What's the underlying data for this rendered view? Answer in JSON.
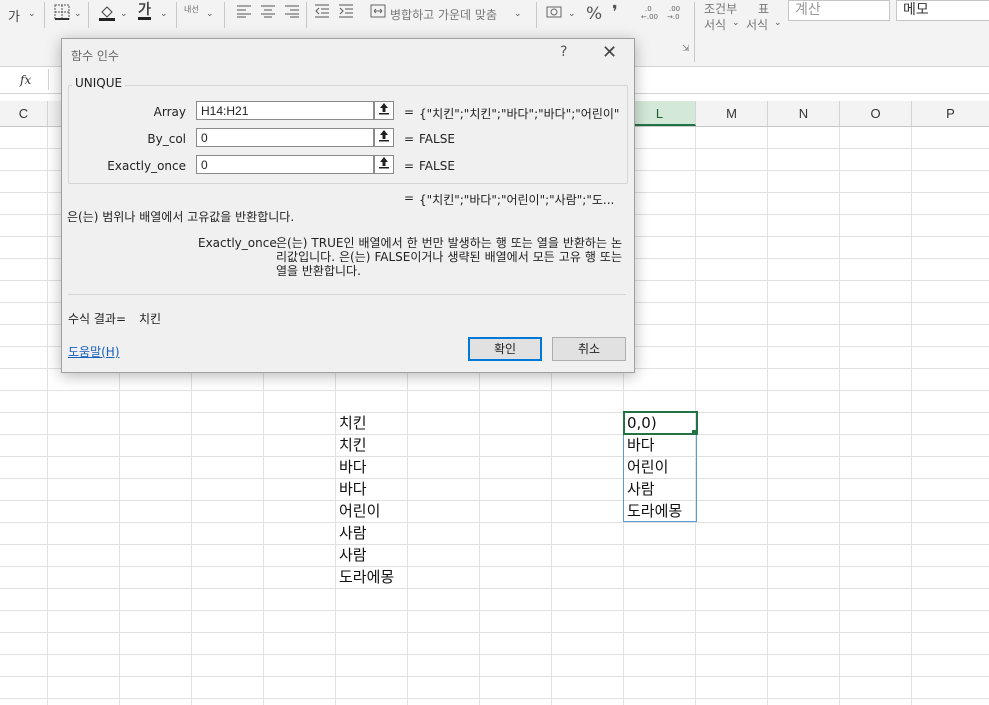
{
  "ribbon": {
    "font_size_glyph": "가",
    "font_color_glyph": "가",
    "border_icon": "border-icon",
    "fill_icon": "fill-color-icon",
    "vertical_text_label": "내선",
    "merge_center_label": "병합하고 가운데 맞춤",
    "percent_label": "%",
    "comma_label": "❜",
    "conditional_format_label": "조건부",
    "conditional_format_sub": "서식",
    "table_format_label": "표",
    "table_format_sub": "서식",
    "style_calc": "계산",
    "style_memo": "메모"
  },
  "formula_bar": {
    "fx_label": "fx"
  },
  "columns": [
    {
      "label": "C"
    },
    {
      "label": ""
    },
    {
      "label": ""
    },
    {
      "label": ""
    },
    {
      "label": ""
    },
    {
      "label": ""
    },
    {
      "label": ""
    },
    {
      "label": ""
    },
    {
      "label": ""
    },
    {
      "label": "L"
    },
    {
      "label": "M"
    },
    {
      "label": "N"
    },
    {
      "label": "O"
    },
    {
      "label": "P"
    }
  ],
  "cells": {
    "h_column": [
      "치킨",
      "치킨",
      "바다",
      "바다",
      "어린이",
      "사람",
      "사람",
      "도라에몽"
    ],
    "l_column": [
      "0,0)",
      "바다",
      "어린이",
      "사람",
      "도라에몽"
    ]
  },
  "dialog": {
    "title": "함수 인수",
    "help_glyph": "?",
    "close_glyph": "✕",
    "function_name": "UNIQUE",
    "args": [
      {
        "label": "Array",
        "value": "H14:H21",
        "result": "{\"치킨\";\"치킨\";\"바다\";\"바다\";\"어린이\""
      },
      {
        "label": "By_col",
        "value": "0",
        "result": "FALSE"
      },
      {
        "label": "Exactly_once",
        "value": "0",
        "result": "FALSE"
      }
    ],
    "equals": "=",
    "formula_result_preview": "{\"치킨\";\"바다\";\"어린이\";\"사람\";\"도...",
    "description": "은(는) 범위나 배열에서 고유값을 반환합니다.",
    "arg_desc_label": "Exactly_once",
    "arg_desc_text": "은(는) TRUE인 배열에서 한 번만 발생하는 행 또는 열을 반환하는 논리값입니다. 은(는) FALSE이거나 생략된 배열에서 모든 고유 행 또는 열을 반환합니다.",
    "result_label": "수식 결과=",
    "result_value": "치킨",
    "help_link": "도움말(H)",
    "ok_label": "확인",
    "cancel_label": "취소"
  },
  "colors": {
    "excel_green": "#217346",
    "spill_blue": "#5b9bd5",
    "link_blue": "#1560bd"
  }
}
